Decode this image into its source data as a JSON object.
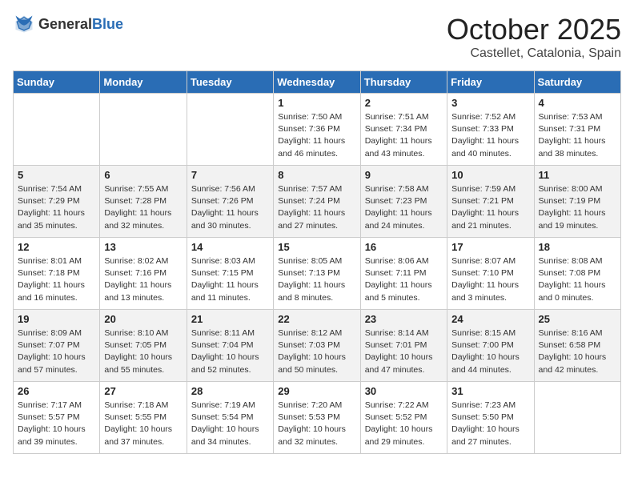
{
  "header": {
    "logo_general": "General",
    "logo_blue": "Blue",
    "month": "October 2025",
    "location": "Castellet, Catalonia, Spain"
  },
  "weekdays": [
    "Sunday",
    "Monday",
    "Tuesday",
    "Wednesday",
    "Thursday",
    "Friday",
    "Saturday"
  ],
  "weeks": [
    [
      {
        "day": "",
        "info": ""
      },
      {
        "day": "",
        "info": ""
      },
      {
        "day": "",
        "info": ""
      },
      {
        "day": "1",
        "info": "Sunrise: 7:50 AM\nSunset: 7:36 PM\nDaylight: 11 hours\nand 46 minutes."
      },
      {
        "day": "2",
        "info": "Sunrise: 7:51 AM\nSunset: 7:34 PM\nDaylight: 11 hours\nand 43 minutes."
      },
      {
        "day": "3",
        "info": "Sunrise: 7:52 AM\nSunset: 7:33 PM\nDaylight: 11 hours\nand 40 minutes."
      },
      {
        "day": "4",
        "info": "Sunrise: 7:53 AM\nSunset: 7:31 PM\nDaylight: 11 hours\nand 38 minutes."
      }
    ],
    [
      {
        "day": "5",
        "info": "Sunrise: 7:54 AM\nSunset: 7:29 PM\nDaylight: 11 hours\nand 35 minutes."
      },
      {
        "day": "6",
        "info": "Sunrise: 7:55 AM\nSunset: 7:28 PM\nDaylight: 11 hours\nand 32 minutes."
      },
      {
        "day": "7",
        "info": "Sunrise: 7:56 AM\nSunset: 7:26 PM\nDaylight: 11 hours\nand 30 minutes."
      },
      {
        "day": "8",
        "info": "Sunrise: 7:57 AM\nSunset: 7:24 PM\nDaylight: 11 hours\nand 27 minutes."
      },
      {
        "day": "9",
        "info": "Sunrise: 7:58 AM\nSunset: 7:23 PM\nDaylight: 11 hours\nand 24 minutes."
      },
      {
        "day": "10",
        "info": "Sunrise: 7:59 AM\nSunset: 7:21 PM\nDaylight: 11 hours\nand 21 minutes."
      },
      {
        "day": "11",
        "info": "Sunrise: 8:00 AM\nSunset: 7:19 PM\nDaylight: 11 hours\nand 19 minutes."
      }
    ],
    [
      {
        "day": "12",
        "info": "Sunrise: 8:01 AM\nSunset: 7:18 PM\nDaylight: 11 hours\nand 16 minutes."
      },
      {
        "day": "13",
        "info": "Sunrise: 8:02 AM\nSunset: 7:16 PM\nDaylight: 11 hours\nand 13 minutes."
      },
      {
        "day": "14",
        "info": "Sunrise: 8:03 AM\nSunset: 7:15 PM\nDaylight: 11 hours\nand 11 minutes."
      },
      {
        "day": "15",
        "info": "Sunrise: 8:05 AM\nSunset: 7:13 PM\nDaylight: 11 hours\nand 8 minutes."
      },
      {
        "day": "16",
        "info": "Sunrise: 8:06 AM\nSunset: 7:11 PM\nDaylight: 11 hours\nand 5 minutes."
      },
      {
        "day": "17",
        "info": "Sunrise: 8:07 AM\nSunset: 7:10 PM\nDaylight: 11 hours\nand 3 minutes."
      },
      {
        "day": "18",
        "info": "Sunrise: 8:08 AM\nSunset: 7:08 PM\nDaylight: 11 hours\nand 0 minutes."
      }
    ],
    [
      {
        "day": "19",
        "info": "Sunrise: 8:09 AM\nSunset: 7:07 PM\nDaylight: 10 hours\nand 57 minutes."
      },
      {
        "day": "20",
        "info": "Sunrise: 8:10 AM\nSunset: 7:05 PM\nDaylight: 10 hours\nand 55 minutes."
      },
      {
        "day": "21",
        "info": "Sunrise: 8:11 AM\nSunset: 7:04 PM\nDaylight: 10 hours\nand 52 minutes."
      },
      {
        "day": "22",
        "info": "Sunrise: 8:12 AM\nSunset: 7:03 PM\nDaylight: 10 hours\nand 50 minutes."
      },
      {
        "day": "23",
        "info": "Sunrise: 8:14 AM\nSunset: 7:01 PM\nDaylight: 10 hours\nand 47 minutes."
      },
      {
        "day": "24",
        "info": "Sunrise: 8:15 AM\nSunset: 7:00 PM\nDaylight: 10 hours\nand 44 minutes."
      },
      {
        "day": "25",
        "info": "Sunrise: 8:16 AM\nSunset: 6:58 PM\nDaylight: 10 hours\nand 42 minutes."
      }
    ],
    [
      {
        "day": "26",
        "info": "Sunrise: 7:17 AM\nSunset: 5:57 PM\nDaylight: 10 hours\nand 39 minutes."
      },
      {
        "day": "27",
        "info": "Sunrise: 7:18 AM\nSunset: 5:55 PM\nDaylight: 10 hours\nand 37 minutes."
      },
      {
        "day": "28",
        "info": "Sunrise: 7:19 AM\nSunset: 5:54 PM\nDaylight: 10 hours\nand 34 minutes."
      },
      {
        "day": "29",
        "info": "Sunrise: 7:20 AM\nSunset: 5:53 PM\nDaylight: 10 hours\nand 32 minutes."
      },
      {
        "day": "30",
        "info": "Sunrise: 7:22 AM\nSunset: 5:52 PM\nDaylight: 10 hours\nand 29 minutes."
      },
      {
        "day": "31",
        "info": "Sunrise: 7:23 AM\nSunset: 5:50 PM\nDaylight: 10 hours\nand 27 minutes."
      },
      {
        "day": "",
        "info": ""
      }
    ]
  ]
}
